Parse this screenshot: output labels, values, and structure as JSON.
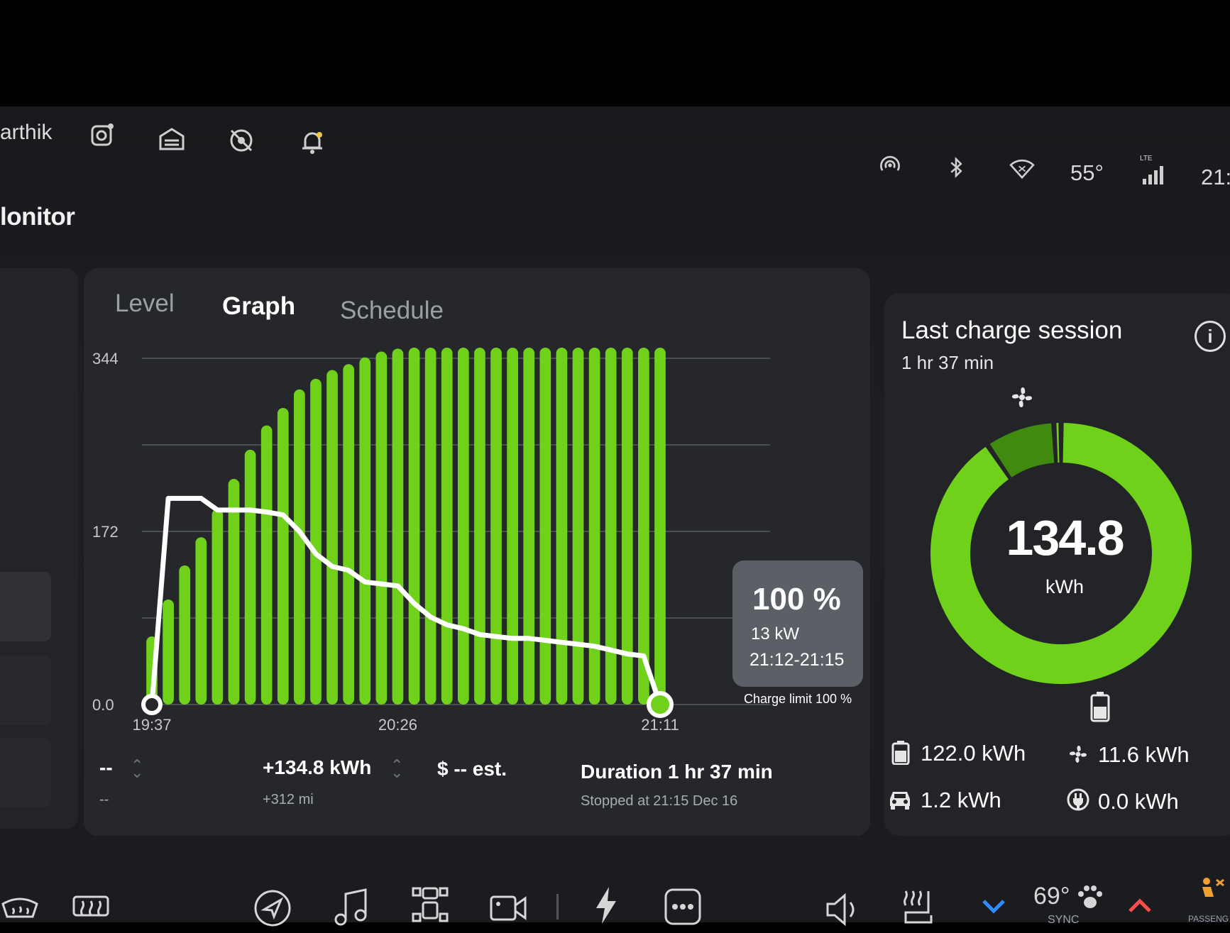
{
  "topbar": {
    "user_name": "arthik",
    "temperature": "55°",
    "network": "LTE",
    "clock": "21:1",
    "icons": [
      "dashcam-icon",
      "garage-icon",
      "sentry-off-icon",
      "notification-bell-icon",
      "hotspot-icon",
      "bluetooth-icon",
      "wifi-icon",
      "cellular-signal-icon"
    ]
  },
  "page": {
    "title": "lonitor"
  },
  "tabs": [
    {
      "label": "Level",
      "active": false
    },
    {
      "label": "Graph",
      "active": true
    },
    {
      "label": "Schedule",
      "active": false
    }
  ],
  "tooltip": {
    "percent": "100 %",
    "power": "13 kW",
    "time_range": "21:12-21:15"
  },
  "charge_limit": "Charge limit 100 %",
  "summary": {
    "left_value": "--",
    "left_sub": "--",
    "energy": "+134.8 kWh",
    "range_added": "+312 mi",
    "cost": "$ -- est.",
    "duration": "Duration 1 hr 37 min",
    "stopped": "Stopped at 21:15 Dec 16"
  },
  "last_session": {
    "title": "Last charge session",
    "duration": "1 hr 37 min",
    "total": "134.8",
    "unit": "kWh",
    "battery": "122.0 kWh",
    "climate": "11.6 kWh",
    "driving": "1.2 kWh",
    "other": "0.0 kWh",
    "accent": "#6fd11a",
    "accent_dark": "#3f8a0f"
  },
  "donut_data": {
    "battery": 122.0,
    "climate": 11.6,
    "driving": 1.2,
    "other": 0.0
  },
  "dock": {
    "cabin_temp": "69°",
    "sync_label": "SYNC",
    "passenger_label": "PASSENG",
    "icons": [
      "defrost-front-icon",
      "defrost-rear-icon",
      "navigation-icon",
      "music-icon",
      "toybox-icon",
      "camera-icon",
      "charging-icon",
      "more-icon",
      "volume-icon",
      "seat-heat-icon",
      "chevron-down-icon",
      "dog-mode-icon",
      "chevron-up-icon",
      "passenger-airbag-icon"
    ]
  },
  "chart_data": {
    "type": "bar",
    "title": "",
    "y_ticks": [
      "344",
      "172",
      "0.0"
    ],
    "ylim": [
      0,
      344
    ],
    "x_ticks": [
      "19:37",
      "20:26",
      "21:11"
    ],
    "bar_color": "#6fd11a",
    "line_color": "#ffffff",
    "series": [
      {
        "type": "bar",
        "values": [
          70,
          108,
          143,
          172,
          201,
          232,
          262,
          287,
          305,
          324,
          335,
          344,
          350,
          357,
          363,
          366,
          367,
          367,
          367,
          367,
          367,
          367,
          367,
          367,
          367,
          367,
          367,
          367,
          367,
          367,
          367,
          367
        ]
      },
      {
        "type": "line",
        "values": [
          0,
          212,
          212,
          212,
          200,
          200,
          200,
          198,
          195,
          178,
          155,
          142,
          138,
          126,
          124,
          122,
          104,
          90,
          82,
          78,
          72,
          70,
          68,
          68,
          66,
          64,
          62,
          60,
          56,
          52,
          50,
          0
        ]
      }
    ]
  }
}
